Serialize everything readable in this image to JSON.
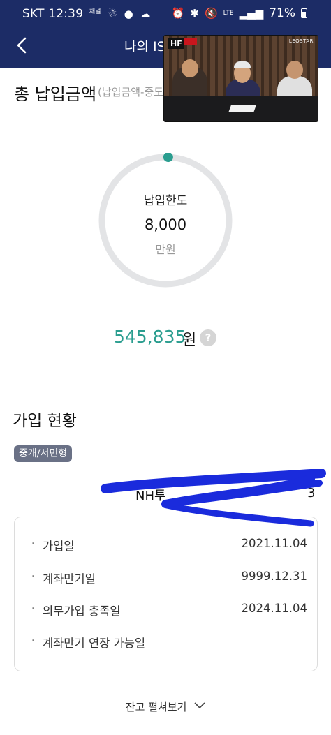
{
  "status_bar": {
    "carrier": "SKT",
    "time": "12:39",
    "battery": "71%",
    "network": "LTE"
  },
  "header": {
    "title": "나의 IS",
    "back_icon": "chevron-left-icon"
  },
  "video_overlay": {
    "logo": "HF",
    "brand": "LEOSTAR"
  },
  "summary": {
    "heading": "총 납입금액",
    "sub_heading": "(납입금액-중도",
    "gauge_label": "납입한도",
    "gauge_value": "8,000",
    "gauge_unit": "만원",
    "gauge_fill": 0.0068,
    "amount": "545,835",
    "amount_unit": "원",
    "help_icon": "question-icon"
  },
  "subscription": {
    "heading": "가입 현황",
    "badge": "중개/서민형",
    "account_prefix": "NH투",
    "account_suffix": "3",
    "rows": [
      {
        "label": "가입일",
        "value": "2021.11.04"
      },
      {
        "label": "계좌만기일",
        "value": "9999.12.31"
      },
      {
        "label": "의무가입 충족일",
        "value": "2024.11.04"
      },
      {
        "label": "계좌만기 연장 가능일",
        "value": ""
      }
    ],
    "expand_label": "잔고 펼쳐보기"
  },
  "colors": {
    "header_bg": "#1c2c66",
    "accent": "#2a9d8f",
    "badge_bg": "#6a7186",
    "redaction": "#1a2bdc"
  }
}
